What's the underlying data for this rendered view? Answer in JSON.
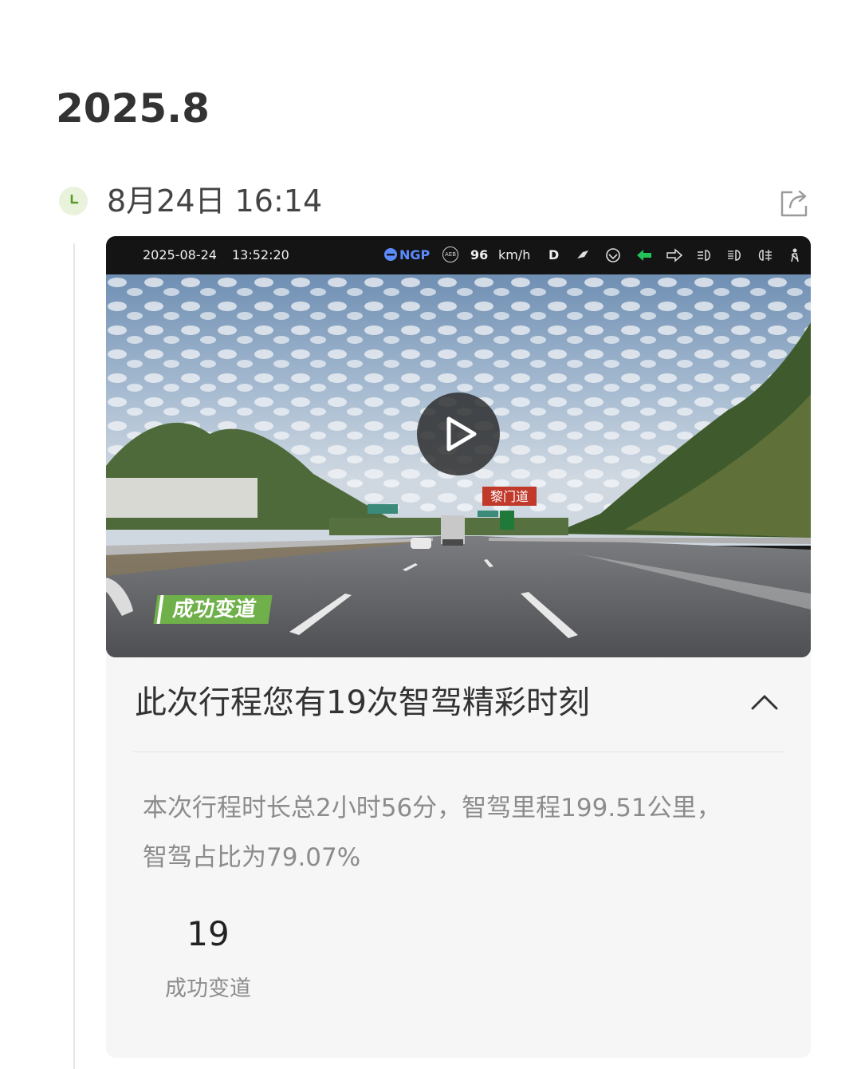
{
  "month_title": "2025.8",
  "entry": {
    "time": "8月24日 16:14"
  },
  "video": {
    "date": "2025-08-24",
    "clock": "13:52:20",
    "ngp_label": "NGP",
    "aeb_label": "AEB",
    "speed": "96",
    "speed_unit": "km/h",
    "gear": "D",
    "overlay_badge": "成功变道",
    "sign_text": "黎门道"
  },
  "summary": {
    "title": "此次行程您有19次智驾精彩时刻",
    "line1": "本次行程时长总2小时56分，智驾里程199.51公里，",
    "line2": "智驾占比为79.07%"
  },
  "stats": [
    {
      "value": "19",
      "label": "成功变道"
    }
  ],
  "colors": {
    "accent_green": "#6fb04a",
    "clock_bg": "#e9f3dc",
    "card_bg": "#f6f6f6",
    "ngp_blue": "#5b8cff",
    "arrow_green": "#22c45a"
  },
  "icons": [
    "clock-icon",
    "share-icon",
    "play-icon",
    "chevron-up-icon",
    "lane-assist-icon",
    "steering-icon",
    "left-turn-arrow-icon",
    "right-turn-arrow-icon",
    "low-beam-icon",
    "high-beam-icon",
    "fog-light-icon",
    "seatbelt-icon"
  ]
}
